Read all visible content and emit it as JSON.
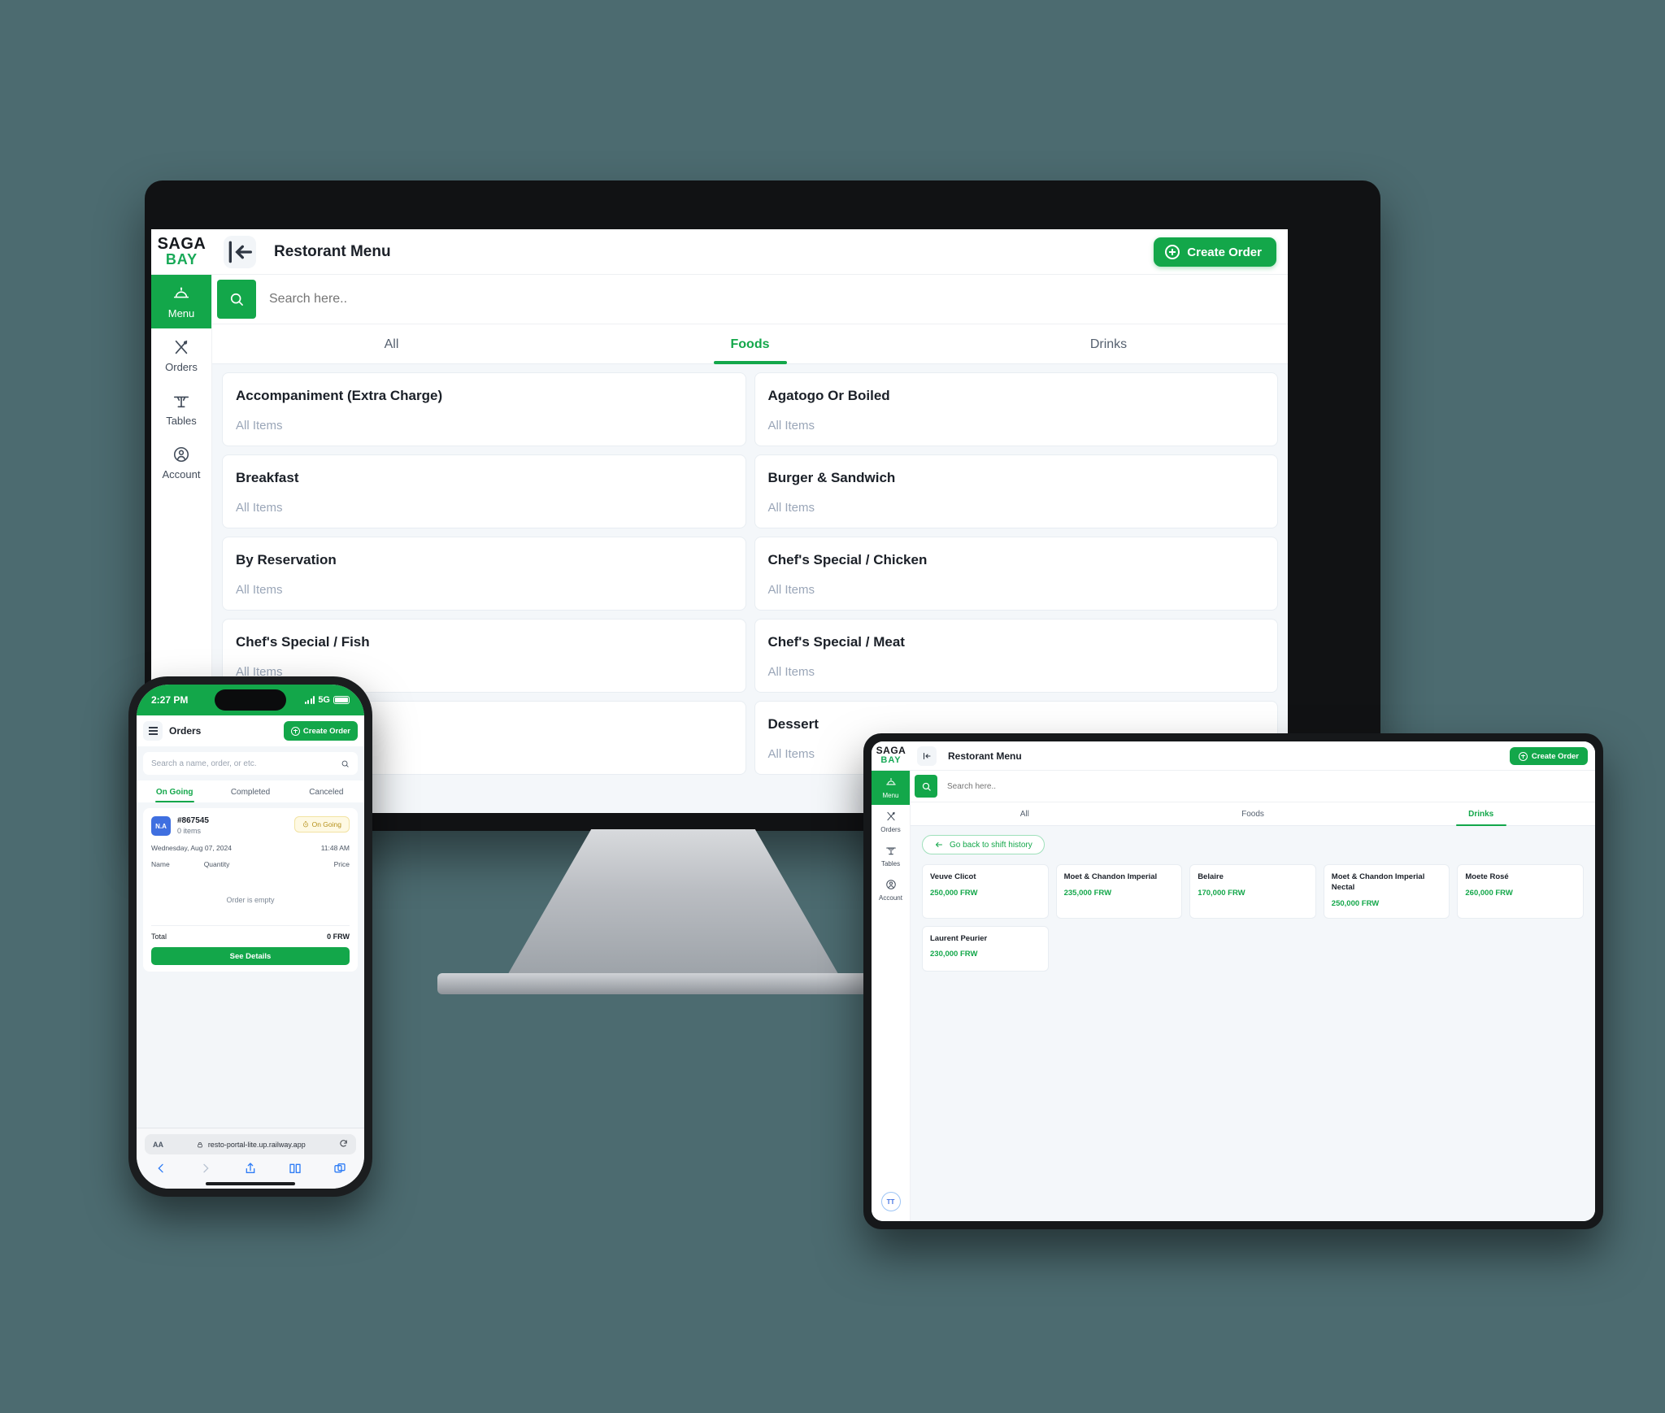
{
  "brand": {
    "name_top": "SAGA",
    "name_bottom": "BAY",
    "accent": "#13a74a"
  },
  "desktop": {
    "header": {
      "title": "Restorant Menu",
      "collapse_icon": "collapse-left-icon",
      "create_order": "Create Order"
    },
    "sidebar": [
      {
        "label": "Menu",
        "icon": "cloche-icon",
        "active": true
      },
      {
        "label": "Orders",
        "icon": "cutlery-icon",
        "active": false
      },
      {
        "label": "Tables",
        "icon": "table-icon",
        "active": false
      },
      {
        "label": "Account",
        "icon": "user-circle-icon",
        "active": false
      }
    ],
    "search": {
      "placeholder": "Search here..",
      "icon": "search-icon"
    },
    "tabs": [
      {
        "label": "All",
        "active": false
      },
      {
        "label": "Foods",
        "active": true
      },
      {
        "label": "Drinks",
        "active": false
      }
    ],
    "categories": [
      {
        "title": "Accompaniment (Extra Charge)",
        "sub": "All Items"
      },
      {
        "title": "Agatogo Or Boiled",
        "sub": "All Items"
      },
      {
        "title": "Breakfast",
        "sub": "All Items"
      },
      {
        "title": "Burger & Sandwich",
        "sub": "All Items"
      },
      {
        "title": "By Reservation",
        "sub": "All Items"
      },
      {
        "title": "Chef's Special / Chicken",
        "sub": "All Items"
      },
      {
        "title": "Chef's Special / Fish",
        "sub": "All Items"
      },
      {
        "title": "Chef's Special / Meat",
        "sub": "All Items"
      },
      {
        "title": "Dessert",
        "sub": "All Items"
      },
      {
        "title": "Dessert",
        "sub": "All Items"
      }
    ]
  },
  "phone": {
    "status": {
      "time": "2:27 PM",
      "network": "5G"
    },
    "header": {
      "title": "Orders",
      "create_order": "Create Order",
      "menu_icon": "hamburger-icon"
    },
    "search": {
      "placeholder": "Search a name, order, or etc.",
      "icon": "search-icon"
    },
    "tabs": [
      {
        "label": "On Going",
        "active": true
      },
      {
        "label": "Completed",
        "active": false
      },
      {
        "label": "Canceled",
        "active": false
      }
    ],
    "order": {
      "avatar": "N.A",
      "id": "#867545",
      "items": "0 items",
      "status": "On Going",
      "status_icon": "clock-icon",
      "date": "Wednesday, Aug 07, 2024",
      "time": "11:48 AM",
      "col_name": "Name",
      "col_quantity": "Quantity",
      "col_price": "Price",
      "empty": "Order is empty",
      "total_label": "Total",
      "total_value": "0 FRW",
      "details_button": "See Details"
    },
    "browser": {
      "aa": "AA",
      "lock_icon": "lock-icon",
      "url": "resto-portal-lite.up.railway.app",
      "reload_icon": "reload-icon",
      "back_icon": "chevron-left-icon",
      "forward_icon": "chevron-right-icon",
      "share_icon": "share-icon",
      "bookmarks_icon": "book-icon",
      "tabs_icon": "tabs-icon"
    }
  },
  "tablet": {
    "header": {
      "title": "Restorant Menu",
      "collapse_icon": "collapse-left-icon",
      "create_order": "Create Order"
    },
    "sidebar": [
      {
        "label": "Menu",
        "icon": "cloche-icon",
        "active": true
      },
      {
        "label": "Orders",
        "icon": "cutlery-icon",
        "active": false
      },
      {
        "label": "Tables",
        "icon": "table-icon",
        "active": false
      },
      {
        "label": "Account",
        "icon": "user-circle-icon",
        "active": false
      }
    ],
    "avatar": "TT",
    "search": {
      "placeholder": "Search here..",
      "icon": "search-icon"
    },
    "tabs": [
      {
        "label": "All",
        "active": false
      },
      {
        "label": "Foods",
        "active": false
      },
      {
        "label": "Drinks",
        "active": true
      }
    ],
    "back_button": {
      "label": "Go back to shift history",
      "icon": "arrow-left-icon"
    },
    "drinks": [
      {
        "name": "Veuve Clicot",
        "price": "250,000 FRW"
      },
      {
        "name": "Moet & Chandon Imperial",
        "price": "235,000 FRW"
      },
      {
        "name": "Belaire",
        "price": "170,000 FRW"
      },
      {
        "name": "Moet & Chandon Imperial Nectal",
        "price": "250,000 FRW"
      },
      {
        "name": "Moete Rosé",
        "price": "260,000 FRW"
      },
      {
        "name": "Laurent Peurier",
        "price": "230,000 FRW"
      }
    ]
  }
}
